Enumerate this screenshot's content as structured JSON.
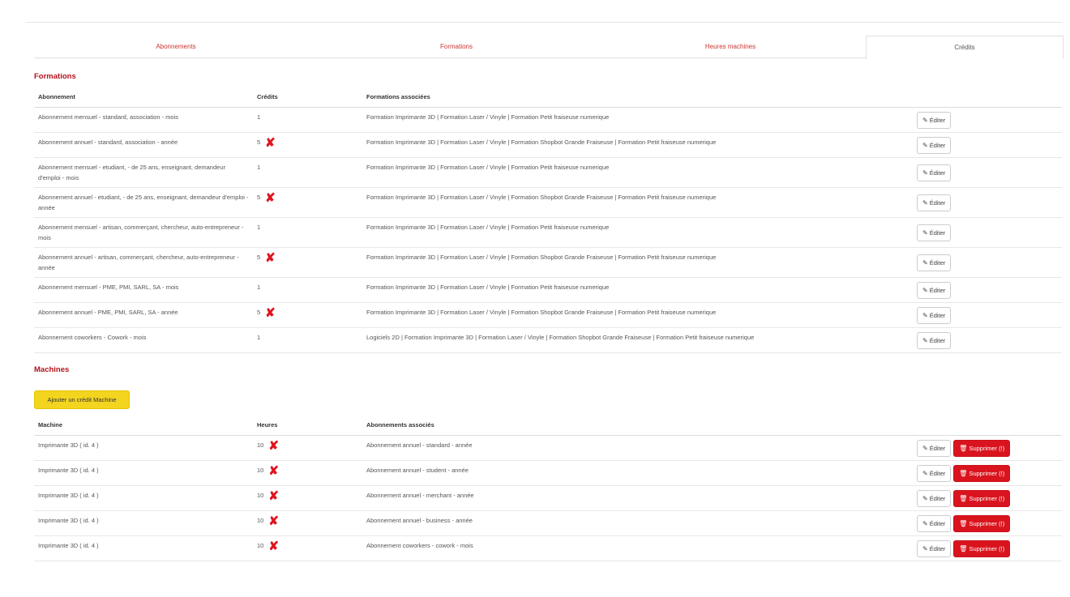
{
  "tabs": [
    {
      "label": "Abonnements",
      "active": false
    },
    {
      "label": "Formations",
      "active": false
    },
    {
      "label": "Heures machines",
      "active": false
    },
    {
      "label": "Crédits",
      "active": true
    }
  ],
  "formations": {
    "title": "Formations",
    "headers": {
      "abonnement": "Abonnement",
      "credits": "Crédits",
      "formations": "Formations associées"
    },
    "edit_label": "Éditer",
    "delete_icon": "red-x-icon",
    "rows": [
      {
        "abonnement": "Abonnement mensuel - standard, association - mois",
        "credits": "1",
        "deletable": false,
        "formations": "Formation Imprimante 3D | Formation Laser / Vinyle | Formation Petit fraiseuse numerique"
      },
      {
        "abonnement": "Abonnement annuel - standard, association - année",
        "credits": "5",
        "deletable": true,
        "formations": "Formation Imprimante 3D | Formation Laser / Vinyle | Formation Shopbot Grande Fraiseuse | Formation Petit fraiseuse numerique"
      },
      {
        "abonnement": "Abonnement mensuel - etudiant, - de 25 ans, enseignant, demandeur d'emploi - mois",
        "credits": "1",
        "deletable": false,
        "formations": "Formation Imprimante 3D | Formation Laser / Vinyle | Formation Petit fraiseuse numerique"
      },
      {
        "abonnement": "Abonnement annuel - etudiant, - de 25 ans, enseignant, demandeur d'emploi - année",
        "credits": "5",
        "deletable": true,
        "formations": "Formation Imprimante 3D | Formation Laser / Vinyle | Formation Shopbot Grande Fraiseuse | Formation Petit fraiseuse numerique"
      },
      {
        "abonnement": "Abonnement mensuel - artisan, commerçant, chercheur, auto-entrepreneur - mois",
        "credits": "1",
        "deletable": false,
        "formations": "Formation Imprimante 3D | Formation Laser / Vinyle | Formation Petit fraiseuse numerique"
      },
      {
        "abonnement": "Abonnement annuel - artisan, commerçant, chercheur, auto-entrepreneur - année",
        "credits": "5",
        "deletable": true,
        "formations": "Formation Imprimante 3D | Formation Laser / Vinyle | Formation Shopbot Grande Fraiseuse | Formation Petit fraiseuse numerique"
      },
      {
        "abonnement": "Abonnement mensuel - PME, PMI, SARL, SA - mois",
        "credits": "1",
        "deletable": false,
        "formations": "Formation Imprimante 3D | Formation Laser / Vinyle | Formation Petit fraiseuse numerique"
      },
      {
        "abonnement": "Abonnement annuel - PME, PMI, SARL, SA - année",
        "credits": "5",
        "deletable": true,
        "formations": "Formation Imprimante 3D | Formation Laser / Vinyle | Formation Shopbot Grande Fraiseuse | Formation Petit fraiseuse numerique"
      },
      {
        "abonnement": "Abonnement coworkers - Cowork - mois",
        "credits": "1",
        "deletable": false,
        "formations": "Logiciels 2D | Formation Imprimante 3D | Formation Laser / Vinyle | Formation Shopbot Grande Fraiseuse | Formation Petit fraiseuse numerique"
      }
    ]
  },
  "machines": {
    "title": "Machines",
    "add_button": "Ajouter un crédit Machine",
    "headers": {
      "machine": "Machine",
      "heures": "Heures",
      "abonnements": "Abonnements associés"
    },
    "edit_label": "Éditer",
    "delete_label": "Supprimer (!)",
    "delete_icon": "red-x-icon",
    "rows": [
      {
        "machine": "Imprimante 3D ( id. 4 )",
        "heures": "10",
        "abonnements": "Abonnement annuel - standard - année"
      },
      {
        "machine": "Imprimante 3D ( id. 4 )",
        "heures": "10",
        "abonnements": "Abonnement annuel - student - année"
      },
      {
        "machine": "Imprimante 3D ( id. 4 )",
        "heures": "10",
        "abonnements": "Abonnement annuel - merchant - année"
      },
      {
        "machine": "Imprimante 3D ( id. 4 )",
        "heures": "10",
        "abonnements": "Abonnement annuel - business - année"
      },
      {
        "machine": "Imprimante 3D ( id. 4 )",
        "heures": "10",
        "abonnements": "Abonnement coworkers - cowork - mois"
      }
    ]
  },
  "colors": {
    "accent_red": "#b5121b",
    "tab_red": "#cc3333",
    "delete_red": "#d9141e",
    "add_yellow": "#f3d41f"
  }
}
